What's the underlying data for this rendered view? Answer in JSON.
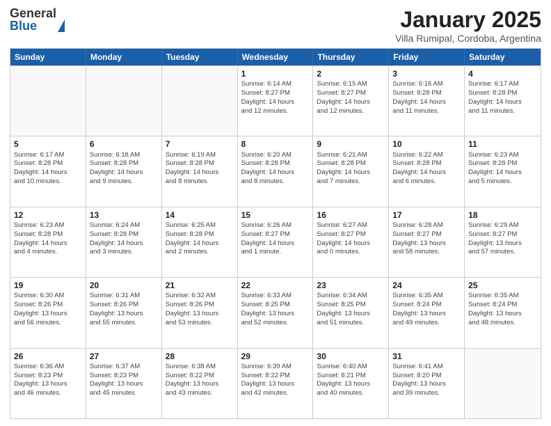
{
  "logo": {
    "general": "General",
    "blue": "Blue"
  },
  "title": "January 2025",
  "subtitle": "Villa Rumipal, Cordoba, Argentina",
  "days": [
    "Sunday",
    "Monday",
    "Tuesday",
    "Wednesday",
    "Thursday",
    "Friday",
    "Saturday"
  ],
  "weeks": [
    [
      {
        "date": "",
        "info": ""
      },
      {
        "date": "",
        "info": ""
      },
      {
        "date": "",
        "info": ""
      },
      {
        "date": "1",
        "info": "Sunrise: 6:14 AM\nSunset: 8:27 PM\nDaylight: 14 hours\nand 12 minutes."
      },
      {
        "date": "2",
        "info": "Sunrise: 6:15 AM\nSunset: 8:27 PM\nDaylight: 14 hours\nand 12 minutes."
      },
      {
        "date": "3",
        "info": "Sunrise: 6:16 AM\nSunset: 8:28 PM\nDaylight: 14 hours\nand 11 minutes."
      },
      {
        "date": "4",
        "info": "Sunrise: 6:17 AM\nSunset: 8:28 PM\nDaylight: 14 hours\nand 11 minutes."
      }
    ],
    [
      {
        "date": "5",
        "info": "Sunrise: 6:17 AM\nSunset: 8:28 PM\nDaylight: 14 hours\nand 10 minutes."
      },
      {
        "date": "6",
        "info": "Sunrise: 6:18 AM\nSunset: 8:28 PM\nDaylight: 14 hours\nand 9 minutes."
      },
      {
        "date": "7",
        "info": "Sunrise: 6:19 AM\nSunset: 8:28 PM\nDaylight: 14 hours\nand 8 minutes."
      },
      {
        "date": "8",
        "info": "Sunrise: 6:20 AM\nSunset: 8:28 PM\nDaylight: 14 hours\nand 8 minutes."
      },
      {
        "date": "9",
        "info": "Sunrise: 6:21 AM\nSunset: 8:28 PM\nDaylight: 14 hours\nand 7 minutes."
      },
      {
        "date": "10",
        "info": "Sunrise: 6:22 AM\nSunset: 8:28 PM\nDaylight: 14 hours\nand 6 minutes."
      },
      {
        "date": "11",
        "info": "Sunrise: 6:23 AM\nSunset: 8:28 PM\nDaylight: 14 hours\nand 5 minutes."
      }
    ],
    [
      {
        "date": "12",
        "info": "Sunrise: 6:23 AM\nSunset: 8:28 PM\nDaylight: 14 hours\nand 4 minutes."
      },
      {
        "date": "13",
        "info": "Sunrise: 6:24 AM\nSunset: 8:28 PM\nDaylight: 14 hours\nand 3 minutes."
      },
      {
        "date": "14",
        "info": "Sunrise: 6:25 AM\nSunset: 8:28 PM\nDaylight: 14 hours\nand 2 minutes."
      },
      {
        "date": "15",
        "info": "Sunrise: 6:26 AM\nSunset: 8:27 PM\nDaylight: 14 hours\nand 1 minute."
      },
      {
        "date": "16",
        "info": "Sunrise: 6:27 AM\nSunset: 8:27 PM\nDaylight: 14 hours\nand 0 minutes."
      },
      {
        "date": "17",
        "info": "Sunrise: 6:28 AM\nSunset: 8:27 PM\nDaylight: 13 hours\nand 58 minutes."
      },
      {
        "date": "18",
        "info": "Sunrise: 6:29 AM\nSunset: 8:27 PM\nDaylight: 13 hours\nand 57 minutes."
      }
    ],
    [
      {
        "date": "19",
        "info": "Sunrise: 6:30 AM\nSunset: 8:26 PM\nDaylight: 13 hours\nand 56 minutes."
      },
      {
        "date": "20",
        "info": "Sunrise: 6:31 AM\nSunset: 8:26 PM\nDaylight: 13 hours\nand 55 minutes."
      },
      {
        "date": "21",
        "info": "Sunrise: 6:32 AM\nSunset: 8:26 PM\nDaylight: 13 hours\nand 53 minutes."
      },
      {
        "date": "22",
        "info": "Sunrise: 6:33 AM\nSunset: 8:25 PM\nDaylight: 13 hours\nand 52 minutes."
      },
      {
        "date": "23",
        "info": "Sunrise: 6:34 AM\nSunset: 8:25 PM\nDaylight: 13 hours\nand 51 minutes."
      },
      {
        "date": "24",
        "info": "Sunrise: 6:35 AM\nSunset: 8:24 PM\nDaylight: 13 hours\nand 49 minutes."
      },
      {
        "date": "25",
        "info": "Sunrise: 6:35 AM\nSunset: 8:24 PM\nDaylight: 13 hours\nand 48 minutes."
      }
    ],
    [
      {
        "date": "26",
        "info": "Sunrise: 6:36 AM\nSunset: 8:23 PM\nDaylight: 13 hours\nand 46 minutes."
      },
      {
        "date": "27",
        "info": "Sunrise: 6:37 AM\nSunset: 8:23 PM\nDaylight: 13 hours\nand 45 minutes."
      },
      {
        "date": "28",
        "info": "Sunrise: 6:38 AM\nSunset: 8:22 PM\nDaylight: 13 hours\nand 43 minutes."
      },
      {
        "date": "29",
        "info": "Sunrise: 6:39 AM\nSunset: 8:22 PM\nDaylight: 13 hours\nand 42 minutes."
      },
      {
        "date": "30",
        "info": "Sunrise: 6:40 AM\nSunset: 8:21 PM\nDaylight: 13 hours\nand 40 minutes."
      },
      {
        "date": "31",
        "info": "Sunrise: 6:41 AM\nSunset: 8:20 PM\nDaylight: 13 hours\nand 39 minutes."
      },
      {
        "date": "",
        "info": ""
      }
    ]
  ]
}
